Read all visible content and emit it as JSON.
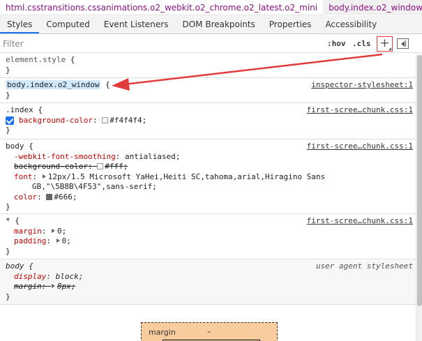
{
  "breadcrumb": {
    "items": [
      {
        "label": "html.csstransitions.cssanimations.o2_webkit.o2_chrome.o2_latest.o2_mini"
      },
      {
        "label": "body.index.o2_window"
      }
    ]
  },
  "tabs": [
    {
      "label": "Styles"
    },
    {
      "label": "Computed"
    },
    {
      "label": "Event Listeners"
    },
    {
      "label": "DOM Breakpoints"
    },
    {
      "label": "Properties"
    },
    {
      "label": "Accessibility"
    }
  ],
  "filter": {
    "placeholder": "Filter",
    "hov": ":hov",
    "cls": ".cls",
    "plus": "+"
  },
  "rules": {
    "element_style": {
      "selector": "element.style",
      "open": "{",
      "close": "}"
    },
    "body_index": {
      "selector": "body.index.o2_window",
      "open": "{",
      "close": "}",
      "source": "inspector-stylesheet:1"
    },
    "index": {
      "selector": ".index",
      "open": "{",
      "close": "}",
      "source": "first-scree…chunk.css:1",
      "decls": [
        {
          "prop": "background-color",
          "value": "#f4f4f4",
          "swatch": "#f4f4f4"
        }
      ]
    },
    "body": {
      "selector": "body",
      "open": "{",
      "close": "}",
      "source": "first-scree…chunk.css:1",
      "decl1_prop": "-webkit-font-smoothing",
      "decl1_val": "antialiased",
      "decl2_prop": "background-color",
      "decl2_val": "#fff",
      "decl3_prop": "font",
      "decl3_val_line1": "12px/1.5 Microsoft YaHei,Heiti SC,tahoma,arial,Hiragino Sans",
      "decl3_val_line2": "GB,\"\\5B8B\\4F53\",sans-serif",
      "decl4_prop": "color",
      "decl4_val": "#666",
      "swatch_white": "#ffffff",
      "swatch_color": "#666666"
    },
    "universal": {
      "selector": "*",
      "open": "{",
      "close": "}",
      "source": "first-scree…chunk.css:1",
      "decl1_prop": "margin",
      "decl1_val": "0",
      "decl2_prop": "padding",
      "decl2_val": "0"
    },
    "ua": {
      "selector": "body",
      "open": "{",
      "close": "}",
      "source": "user agent stylesheet",
      "decl1_prop": "display",
      "decl1_val": "block",
      "decl2_prop": "margin",
      "decl2_val": "8px"
    }
  },
  "boxmodel": {
    "label": "margin",
    "value": "–"
  },
  "colors": {
    "accent": "#1a73e8",
    "annotation": "#e23b3b",
    "margin": "#f9cc9d"
  }
}
